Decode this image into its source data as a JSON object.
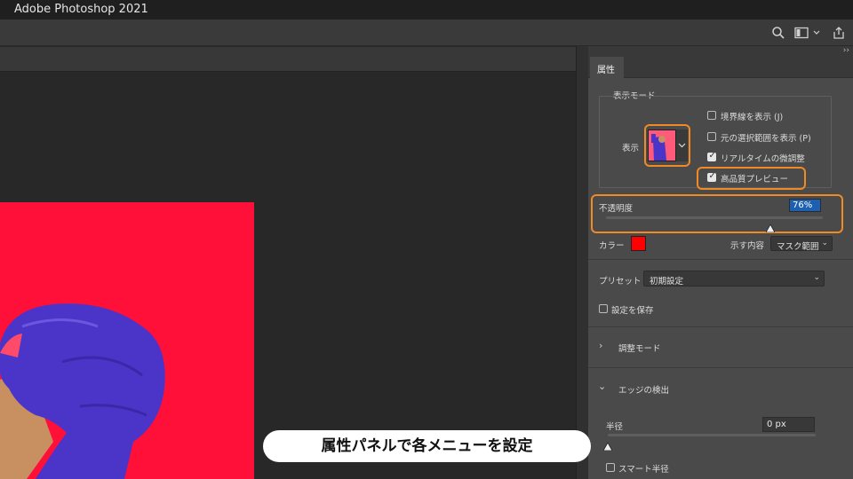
{
  "app": {
    "title": "Adobe Photoshop 2021"
  },
  "toolbar": {
    "icons": [
      "search-icon",
      "workspace-icon",
      "chevron-down-icon",
      "share-icon"
    ]
  },
  "panel": {
    "tab": "属性",
    "view_mode": {
      "group_label": "表示モード",
      "view_label": "表示",
      "options": [
        {
          "label": "境界線を表示 (J)",
          "checked": false
        },
        {
          "label": "元の選択範囲を表示 (P)",
          "checked": false
        },
        {
          "label": "リアルタイムの微調整",
          "checked": true
        },
        {
          "label": "高品質プレビュー",
          "checked": true
        }
      ]
    },
    "opacity": {
      "label": "不透明度",
      "value": "76%",
      "level": 0.76
    },
    "color": {
      "label": "カラー",
      "swatch": "#ff0000"
    },
    "indicates": {
      "label": "示す内容",
      "value": "マスク範囲"
    },
    "preset": {
      "label": "プリセット",
      "value": "初期設定"
    },
    "save_settings": {
      "label": "設定を保存",
      "checked": false
    },
    "adjust_mode": {
      "label": "調整モード"
    },
    "edge_detection": {
      "label": "エッジの検出",
      "radius_label": "半径",
      "radius_value": "0 px",
      "radius_level": 0,
      "smart_radius_label": "スマート半径",
      "smart_radius_checked": false
    }
  },
  "caption": {
    "text": "属性パネルで各メニューを設定"
  },
  "colors": {
    "accent_orange": "#f08a24",
    "canvas_red": "#ff1038",
    "jacket_blue": "#4a35c8"
  }
}
